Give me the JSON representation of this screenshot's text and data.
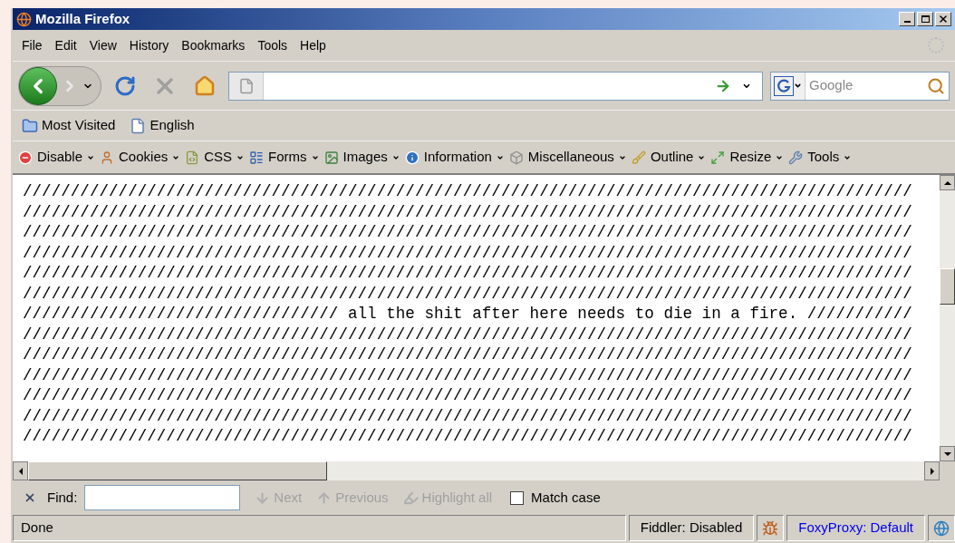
{
  "window": {
    "title": "Mozilla Firefox"
  },
  "menu": [
    {
      "label": "File"
    },
    {
      "label": "Edit"
    },
    {
      "label": "View"
    },
    {
      "label": "History"
    },
    {
      "label": "Bookmarks"
    },
    {
      "label": "Tools"
    },
    {
      "label": "Help"
    }
  ],
  "search": {
    "placeholder": "Google"
  },
  "bookmarks": [
    {
      "label": "Most Visited",
      "kind": "folder"
    },
    {
      "label": "English",
      "kind": "page"
    }
  ],
  "dev_toolbar": [
    {
      "label": "Disable"
    },
    {
      "label": "Cookies"
    },
    {
      "label": "CSS"
    },
    {
      "label": "Forms"
    },
    {
      "label": "Images"
    },
    {
      "label": "Information"
    },
    {
      "label": "Miscellaneous"
    },
    {
      "label": "Outline"
    },
    {
      "label": "Resize"
    },
    {
      "label": "Tools"
    }
  ],
  "content": {
    "lines": [
      "/////////////////////////////////////////////////////////////////////////////////////////////",
      "/////////////////////////////////////////////////////////////////////////////////////////////",
      "/////////////////////////////////////////////////////////////////////////////////////////////",
      "/////////////////////////////////////////////////////////////////////////////////////////////",
      "/////////////////////////////////////////////////////////////////////////////////////////////",
      "/////////////////////////////////////////////////////////////////////////////////////////////",
      "///////////////////////////////// all the shit after here needs to die in a fire. ///////////",
      "/////////////////////////////////////////////////////////////////////////////////////////////",
      "/////////////////////////////////////////////////////////////////////////////////////////////",
      "/////////////////////////////////////////////////////////////////////////////////////////////",
      "/////////////////////////////////////////////////////////////////////////////////////////////",
      "/////////////////////////////////////////////////////////////////////////////////////////////",
      "/////////////////////////////////////////////////////////////////////////////////////////////"
    ]
  },
  "find_bar": {
    "label": "Find:",
    "buttons": [
      {
        "label": "Next",
        "disabled": true
      },
      {
        "label": "Previous",
        "disabled": true
      },
      {
        "label": "Highlight all",
        "disabled": true
      }
    ],
    "match_case": {
      "label": "Match case",
      "checked": false
    }
  },
  "status_bar": {
    "text": "Done",
    "panels": [
      {
        "text": "Fiddler: Disabled",
        "kind": "plain"
      },
      {
        "text": "FoxyProxy: Default",
        "kind": "link"
      }
    ]
  }
}
